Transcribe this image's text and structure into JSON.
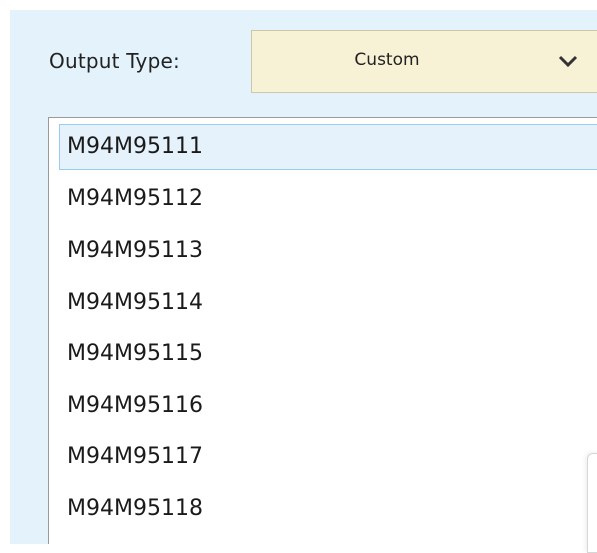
{
  "output_type": {
    "label": "Output Type:",
    "selected_value": "Custom"
  },
  "icons": {
    "dropdown_arrow": "chevron-down-icon"
  },
  "colors": {
    "panel_background": "#e3f2fb",
    "dropdown_background": "#f7f1d6",
    "selected_item_background": "#e5f2fb",
    "selected_item_border": "#99cdee"
  },
  "list": {
    "selected_index": 0,
    "items": [
      "M94M95111",
      "M94M95112",
      "M94M95113",
      "M94M95114",
      "M94M95115",
      "M94M95116",
      "M94M95117",
      "M94M95118"
    ]
  }
}
